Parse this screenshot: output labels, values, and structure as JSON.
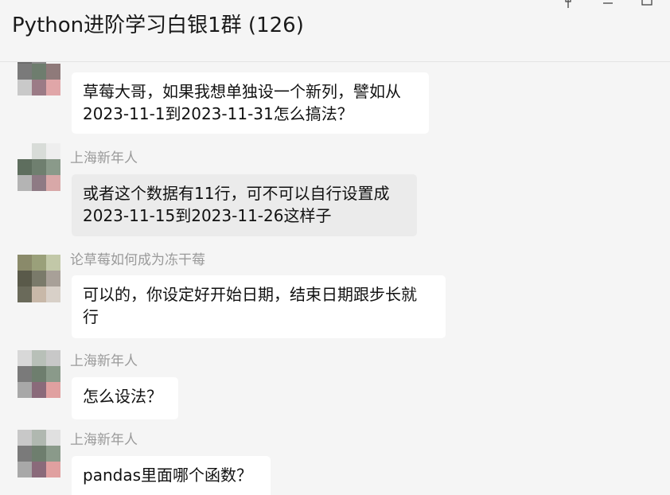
{
  "window": {
    "title": "Python进阶学习白银1群 (126)",
    "controls": {
      "pin": "pin-icon",
      "minimize": "minimize-icon",
      "maximize": "maximize-icon"
    }
  },
  "messages": [
    {
      "sender": "",
      "lines": [
        "草莓大哥，如果我想单独设一个新列，譬如从",
        "2023-11-1到2023-11-31怎么搞法？"
      ],
      "bubble_color": "#ffffff"
    },
    {
      "sender": "上海新年人",
      "lines": [
        "或者这个数据有11行，可不可以自行设置成",
        "2023-11-15到2023-11-26这样子"
      ],
      "bubble_color": "#ebebeb"
    },
    {
      "sender": "论草莓如何成为冻干莓",
      "lines": [
        "可以的，你设定好开始日期，结束日期跟步长就",
        "行"
      ],
      "bubble_color": "#ffffff"
    },
    {
      "sender": "上海新年人",
      "lines": [
        "怎么设法？"
      ],
      "bubble_color": "#ffffff"
    },
    {
      "sender": "上海新年人",
      "lines": [
        "pandas里面哪个函数？"
      ],
      "bubble_color": "#ffffff"
    }
  ],
  "colors": {
    "background": "#f5f5f5",
    "sender_text": "#9a9a9a",
    "bubble_white": "#ffffff",
    "bubble_grey": "#ebebeb"
  }
}
